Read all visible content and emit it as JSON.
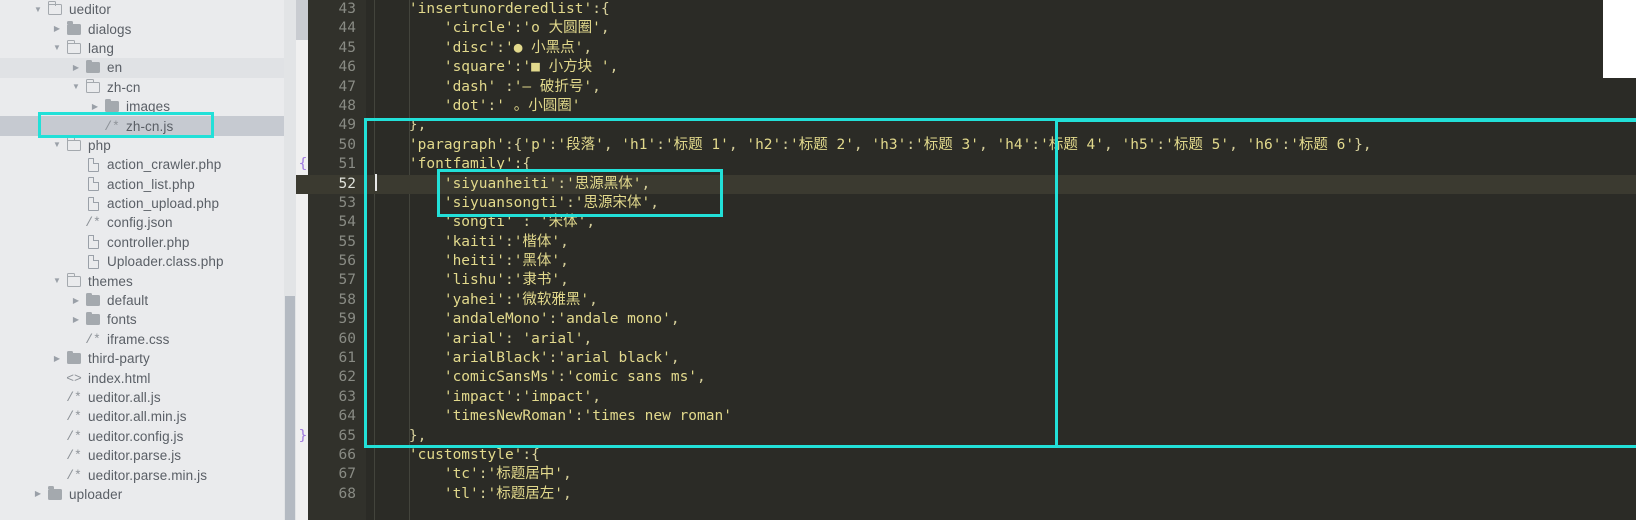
{
  "window": {
    "accent_cyan": "#22e0d8",
    "editor_bg": "#2b2b26",
    "sidebar_bg": "#eaebed"
  },
  "sidebar": {
    "name": "file-explorer",
    "items": [
      {
        "label": "ueditor",
        "depth": 1,
        "type": "folder-open",
        "twisty": "down",
        "state": "normal"
      },
      {
        "label": "dialogs",
        "depth": 2,
        "type": "folder-closed",
        "twisty": "right",
        "state": "normal"
      },
      {
        "label": "lang",
        "depth": 2,
        "type": "folder-open",
        "twisty": "down",
        "state": "normal"
      },
      {
        "label": "en",
        "depth": 3,
        "type": "folder-closed",
        "twisty": "right",
        "state": "alt"
      },
      {
        "label": "zh-cn",
        "depth": 3,
        "type": "folder-open",
        "twisty": "down",
        "state": "normal"
      },
      {
        "label": "images",
        "depth": 4,
        "type": "folder-closed",
        "twisty": "right",
        "state": "normal"
      },
      {
        "label": "zh-cn.js",
        "depth": 4,
        "type": "js",
        "twisty": "none",
        "state": "selected"
      },
      {
        "label": "php",
        "depth": 2,
        "type": "folder-open",
        "twisty": "down",
        "state": "normal"
      },
      {
        "label": "action_crawler.php",
        "depth": 3,
        "type": "file",
        "twisty": "none",
        "state": "normal"
      },
      {
        "label": "action_list.php",
        "depth": 3,
        "type": "file",
        "twisty": "none",
        "state": "normal"
      },
      {
        "label": "action_upload.php",
        "depth": 3,
        "type": "file",
        "twisty": "none",
        "state": "normal"
      },
      {
        "label": "config.json",
        "depth": 3,
        "type": "js",
        "twisty": "none",
        "state": "normal"
      },
      {
        "label": "controller.php",
        "depth": 3,
        "type": "file",
        "twisty": "none",
        "state": "normal"
      },
      {
        "label": "Uploader.class.php",
        "depth": 3,
        "type": "file",
        "twisty": "none",
        "state": "normal"
      },
      {
        "label": "themes",
        "depth": 2,
        "type": "folder-open",
        "twisty": "down",
        "state": "normal"
      },
      {
        "label": "default",
        "depth": 3,
        "type": "folder-closed",
        "twisty": "right",
        "state": "normal"
      },
      {
        "label": "fonts",
        "depth": 3,
        "type": "folder-closed",
        "twisty": "right",
        "state": "normal"
      },
      {
        "label": "iframe.css",
        "depth": 3,
        "type": "js",
        "twisty": "none",
        "state": "normal"
      },
      {
        "label": "third-party",
        "depth": 2,
        "type": "folder-closed",
        "twisty": "right",
        "state": "normal"
      },
      {
        "label": "index.html",
        "depth": 2,
        "type": "html",
        "twisty": "none",
        "state": "normal"
      },
      {
        "label": "ueditor.all.js",
        "depth": 2,
        "type": "js",
        "twisty": "none",
        "state": "normal"
      },
      {
        "label": "ueditor.all.min.js",
        "depth": 2,
        "type": "js",
        "twisty": "none",
        "state": "normal"
      },
      {
        "label": "ueditor.config.js",
        "depth": 2,
        "type": "js",
        "twisty": "none",
        "state": "normal"
      },
      {
        "label": "ueditor.parse.js",
        "depth": 2,
        "type": "js",
        "twisty": "none",
        "state": "normal"
      },
      {
        "label": "ueditor.parse.min.js",
        "depth": 2,
        "type": "js",
        "twisty": "none",
        "state": "normal"
      },
      {
        "label": "uploader",
        "depth": 1,
        "type": "folder-closed",
        "twisty": "right",
        "state": "normal"
      }
    ]
  },
  "editor": {
    "name": "code-editor",
    "current_line": 52,
    "first_line": 43,
    "lines": [
      {
        "n": 43,
        "brace": "",
        "text": "    'insertunorderedlist':{"
      },
      {
        "n": 44,
        "brace": "",
        "text": "        'circle':'o 大圆圈',"
      },
      {
        "n": 45,
        "brace": "",
        "text": "        'disc':'● 小黑点',"
      },
      {
        "n": 46,
        "brace": "",
        "text": "        'square':'■ 小方块 ',"
      },
      {
        "n": 47,
        "brace": "",
        "text": "        'dash' :'— 破折号',"
      },
      {
        "n": 48,
        "brace": "",
        "text": "        'dot':' 。小圆圈'"
      },
      {
        "n": 49,
        "brace": "",
        "text": "    },"
      },
      {
        "n": 50,
        "brace": "",
        "text": "    'paragraph':{'p':'段落', 'h1':'标题 1', 'h2':'标题 2', 'h3':'标题 3', 'h4':'标题 4', 'h5':'标题 5', 'h6':'标题 6'},"
      },
      {
        "n": 51,
        "brace": "{",
        "text": "    'fontfamily':{"
      },
      {
        "n": 52,
        "brace": "",
        "text": "        'siyuanheiti':'思源黑体',"
      },
      {
        "n": 53,
        "brace": "",
        "text": "        'siyuansongti':'思源宋体',"
      },
      {
        "n": 54,
        "brace": "",
        "text": "        'songti' : '宋体',"
      },
      {
        "n": 55,
        "brace": "",
        "text": "        'kaiti':'楷体',"
      },
      {
        "n": 56,
        "brace": "",
        "text": "        'heiti':'黑体',"
      },
      {
        "n": 57,
        "brace": "",
        "text": "        'lishu':'隶书',"
      },
      {
        "n": 58,
        "brace": "",
        "text": "        'yahei':'微软雅黑',"
      },
      {
        "n": 59,
        "brace": "",
        "text": "        'andaleMono':'andale mono',"
      },
      {
        "n": 60,
        "brace": "",
        "text": "        'arial': 'arial',"
      },
      {
        "n": 61,
        "brace": "",
        "text": "        'arialBlack':'arial black',"
      },
      {
        "n": 62,
        "brace": "",
        "text": "        'comicSansMs':'comic sans ms',"
      },
      {
        "n": 63,
        "brace": "",
        "text": "        'impact':'impact',"
      },
      {
        "n": 64,
        "brace": "",
        "text": "        'timesNewRoman':'times new roman'"
      },
      {
        "n": 65,
        "brace": "}",
        "text": "    },"
      },
      {
        "n": 66,
        "brace": "",
        "text": "    'customstyle':{"
      },
      {
        "n": 67,
        "brace": "",
        "text": "        'tc':'标题居中',"
      },
      {
        "n": 68,
        "brace": "",
        "text": "        'tl':'标题居左',"
      }
    ]
  },
  "annotations": {
    "file_box_target": "zh-cn.js",
    "block_box_target": "fontfamily block lines 49-66",
    "inner_box_target": "siyuanheiti / siyuansongti entries"
  }
}
